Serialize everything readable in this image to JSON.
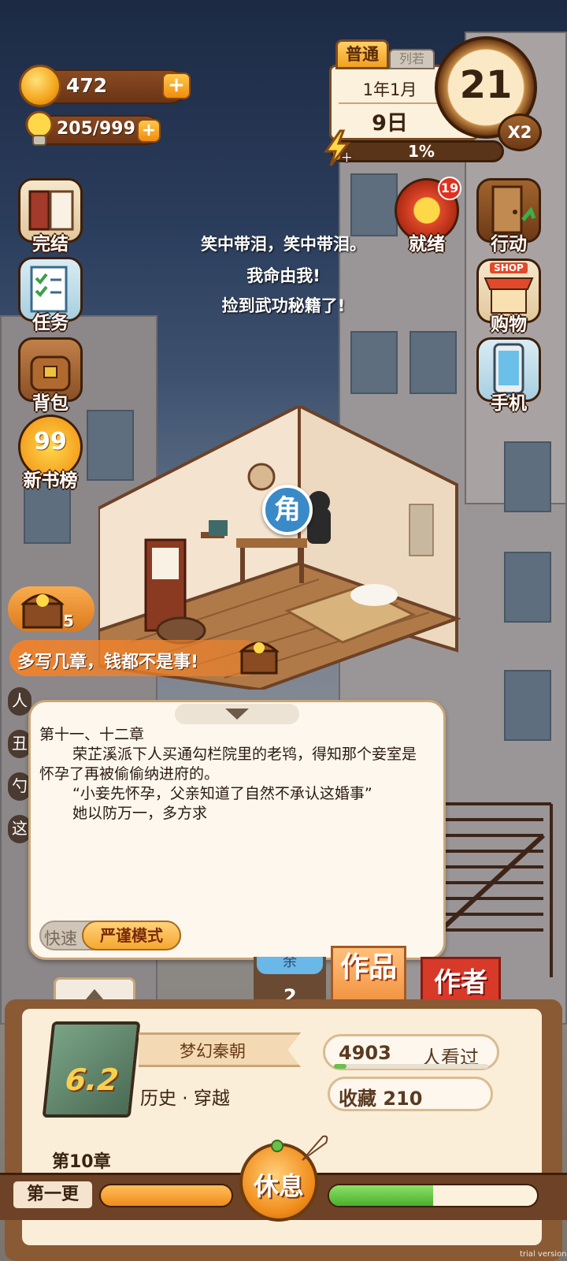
{
  "resources": {
    "coins": "472",
    "energy": "205/999"
  },
  "calendar": {
    "mode": "普通",
    "tab_partial": "列若",
    "month": "1年1月",
    "day": "9日",
    "counter": "21",
    "multiplier": "X2",
    "progress": "1%",
    "progress_value": 0.01
  },
  "left_menu": [
    {
      "label": "完结",
      "icon": "book-icon"
    },
    {
      "label": "任务",
      "icon": "task-list-icon"
    },
    {
      "label": "背包",
      "icon": "backpack-icon"
    },
    {
      "label": "新书榜",
      "icon": "ranking-99-icon",
      "badge": "99"
    }
  ],
  "right_menu": [
    {
      "label": "就绪",
      "icon": "ready-dial-icon",
      "badge": "19"
    },
    {
      "label": "行动",
      "icon": "door-icon"
    },
    {
      "label": "购物",
      "icon": "shop-icon",
      "sign": "SHOP"
    },
    {
      "label": "手机",
      "icon": "phone-icon"
    }
  ],
  "floating_messages": [
    "笑中带泪，笑中带泪。",
    "我命由我!",
    "捡到武功秘籍了!"
  ],
  "character_marker": "角",
  "treasure": {
    "count": "5"
  },
  "tip_banner": "多写几章，钱都不是事!",
  "side_partial_chars": [
    "人",
    "丑",
    "勺",
    "这"
  ],
  "writing_panel": {
    "chapter_title": "第十一、十二章",
    "paragraphs": [
      "荣芷溪派下人买通勾栏院里的老鸨，得知那个妾室是怀孕了再被偷偷纳进府的。",
      "“小妾先怀孕，父亲知道了自然不承认这婚事”",
      "她以防万一，多方求"
    ],
    "mode_fast": "快速",
    "mode_strict": "严谨模式"
  },
  "bottom_tabs": {
    "partial_tab": "余",
    "partial_count": "2",
    "works": "作品",
    "author": "作者"
  },
  "book": {
    "title": "梦幻秦朝",
    "rating": "6.2",
    "genre": "历史 · 穿越",
    "chapter": "第10章",
    "views": "4903",
    "views_label": "人看过",
    "favorites": "收藏 210"
  },
  "footer": {
    "update_label": "第一更",
    "rest_button": "休息",
    "left_bar_value": 1.0,
    "right_bar_value": 0.5
  },
  "watermark": "trial version"
}
